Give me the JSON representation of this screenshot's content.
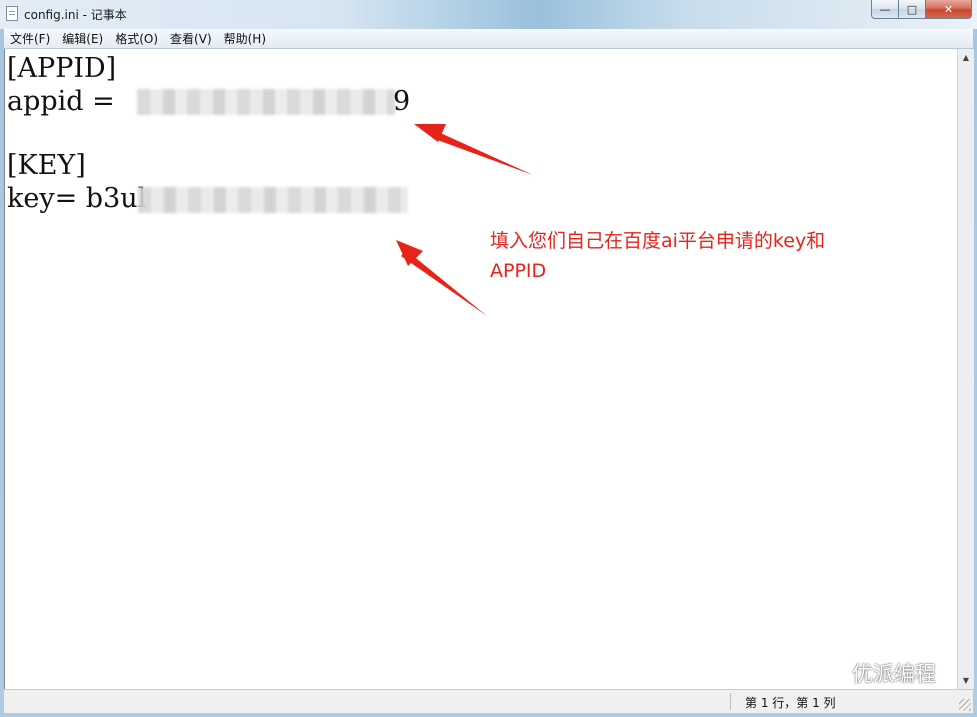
{
  "window": {
    "title": "config.ini - 记事本",
    "controls": {
      "minimize_glyph": "—",
      "maximize_glyph": "□",
      "close_glyph": "✕"
    }
  },
  "menu": {
    "items": [
      "文件(F)",
      "编辑(E)",
      "格式(O)",
      "查看(V)",
      "帮助(H)"
    ]
  },
  "editor": {
    "lines": [
      "[APPID]",
      "appid = ",
      "",
      "[KEY]",
      "key= b3ul"
    ],
    "visible_tail": {
      "appid_tail": "9"
    }
  },
  "status": {
    "position": "第 1 行，第 1 列"
  },
  "annotation": {
    "text_line1": "填入您们自己在百度ai平台申请的key和",
    "text_line2": "APPID",
    "color": "#e8231a"
  },
  "watermark": {
    "text": "优派编程",
    "icon": "wechat-icon"
  }
}
